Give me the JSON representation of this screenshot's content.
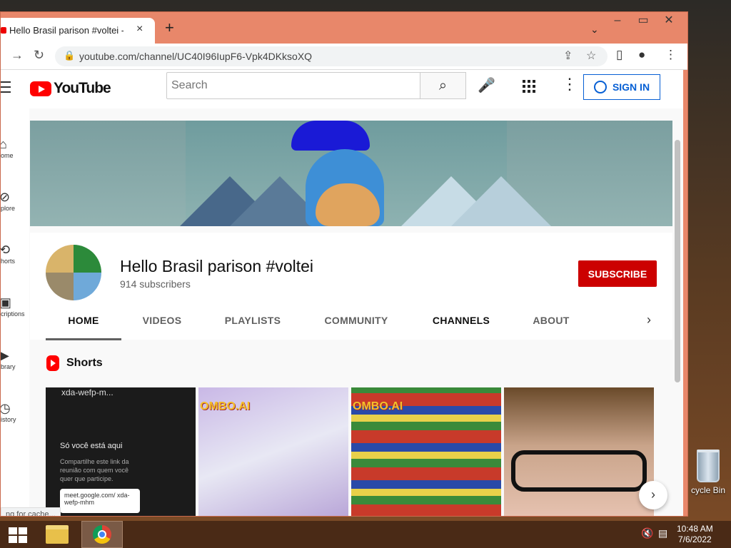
{
  "browser": {
    "tab_title": "Hello Brasil parison #voltei - You",
    "tab_close": "×",
    "new_tab": "+",
    "url": "youtube.com/channel/UC40I96IupF6-Vpk4DKksoXQ",
    "status_text": "ng for cache..."
  },
  "youtube": {
    "logo_text": "YouTube",
    "search_placeholder": "Search",
    "sign_in": "SIGN IN",
    "sidebar": [
      {
        "label": "ome",
        "icon": "home-icon"
      },
      {
        "label": "plore",
        "icon": "explore-icon"
      },
      {
        "label": "horts",
        "icon": "shorts-icon"
      },
      {
        "label": "criptions",
        "icon": "subscriptions-icon"
      },
      {
        "label": "brary",
        "icon": "library-icon"
      },
      {
        "label": "istory",
        "icon": "history-icon"
      }
    ]
  },
  "channel": {
    "name": "Hello Brasil parison #voltei",
    "subscribers": "914 subscribers",
    "subscribe_label": "SUBSCRIBE",
    "tabs": [
      "HOME",
      "VIDEOS",
      "PLAYLISTS",
      "COMMUNITY",
      "CHANNELS",
      "ABOUT"
    ],
    "active_tab": "HOME"
  },
  "shorts": {
    "title": "Shorts",
    "thumb1": {
      "top": "xda-wefp-m...",
      "message": "Só você está aqui",
      "sub": "Compartilhe este link da reunião com quem você quer que participe.",
      "link": "meet.google.com/ xda-wefp-mhm"
    },
    "thumb2_label": "OMBO.AI",
    "thumb3_label": "OMBO.AI"
  },
  "desktop": {
    "recycle_bin": "cycle Bin",
    "time": "10:48 AM",
    "date": "7/6/2022"
  },
  "colors": {
    "window_frame": "#e8876a",
    "youtube_red": "#ff0000",
    "subscribe_red": "#cc0000",
    "signin_blue": "#065fd4"
  }
}
